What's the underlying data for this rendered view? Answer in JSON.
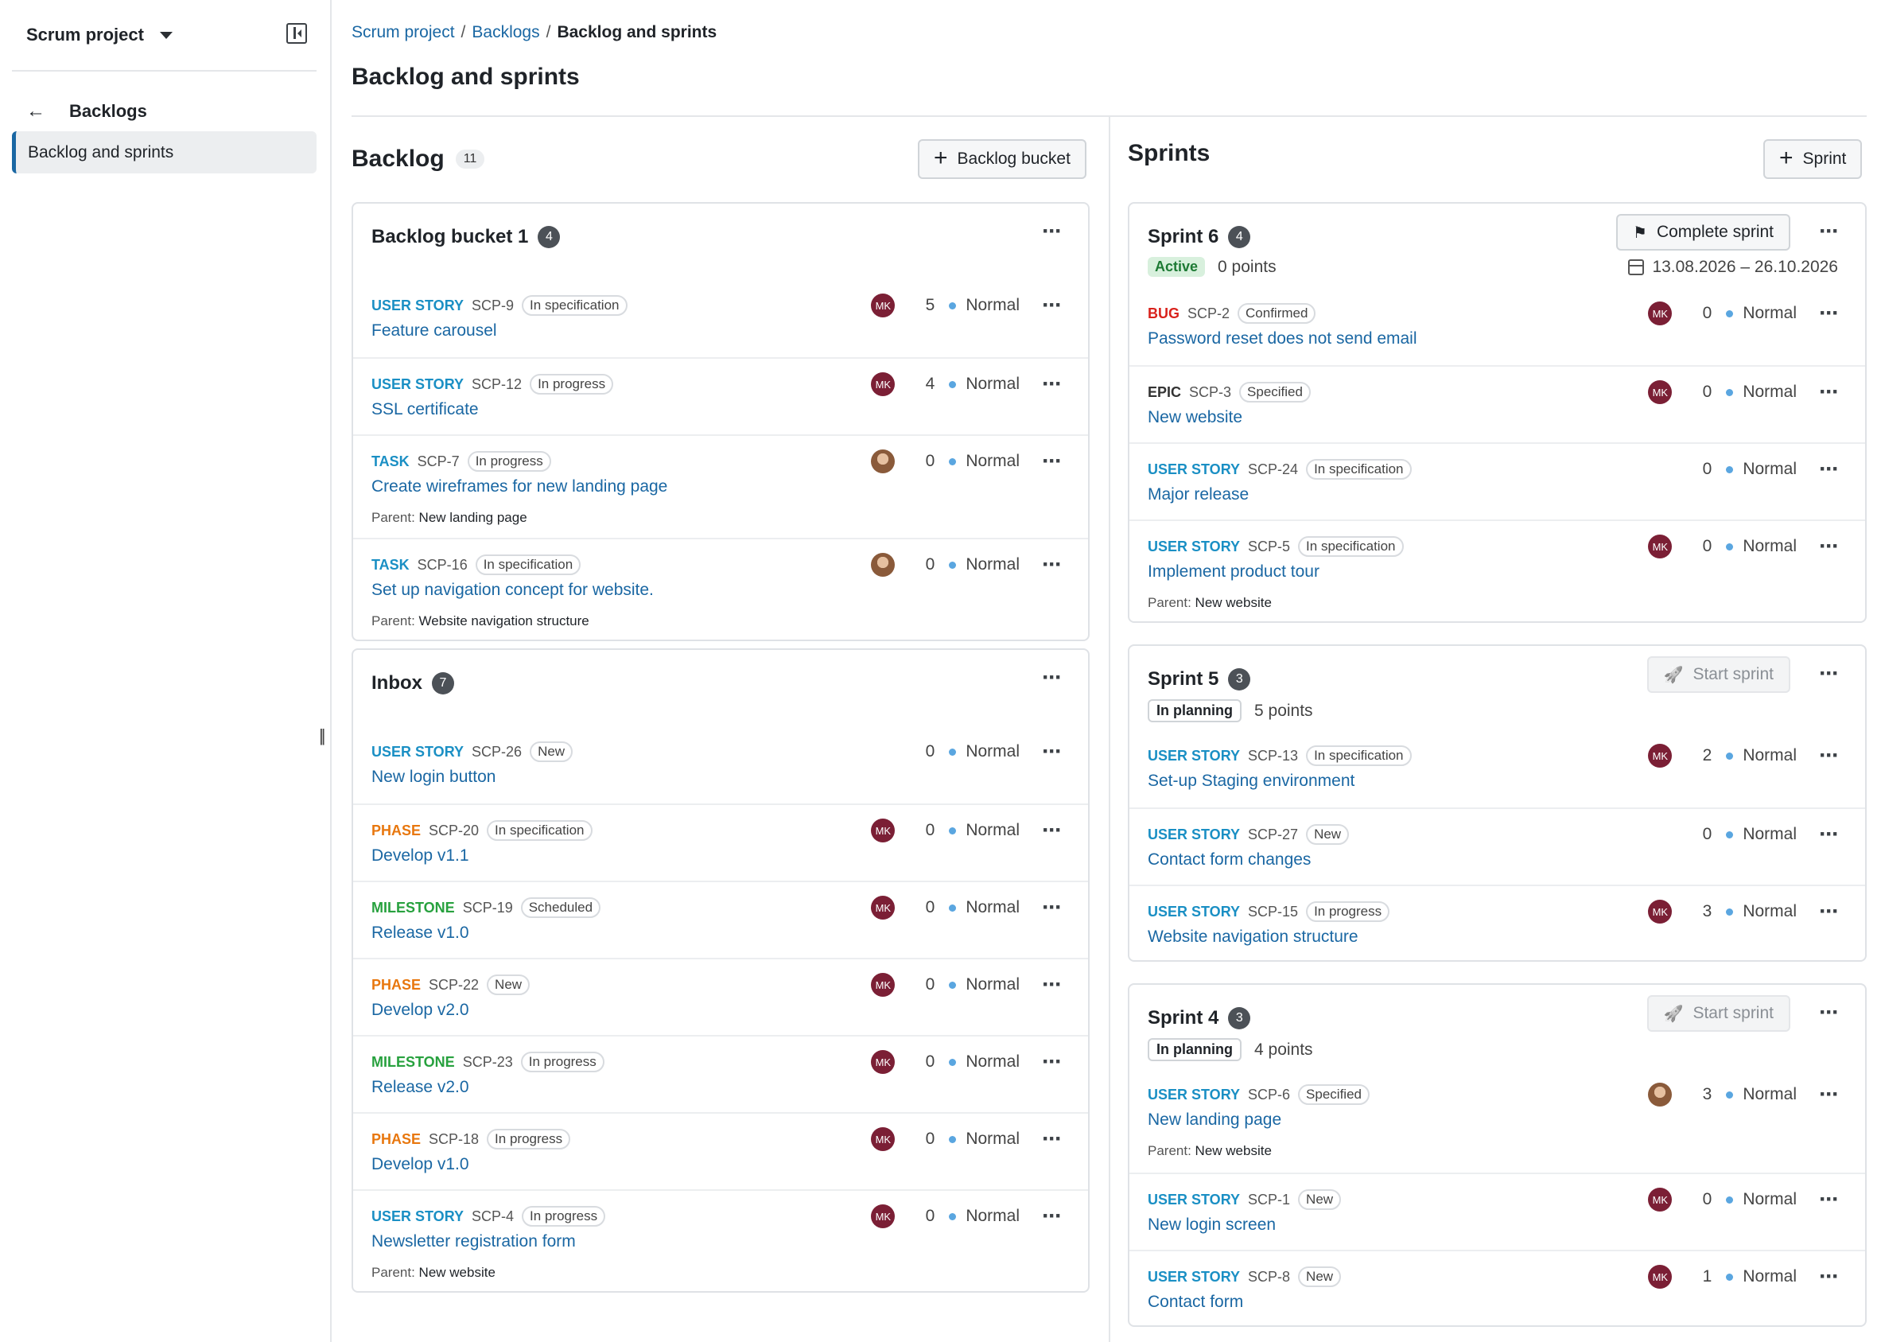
{
  "sidebar": {
    "project": "Scrum project",
    "back_label": "Backlogs",
    "active_item": "Backlog and sprints"
  },
  "breadcrumb": [
    "Scrum project",
    "Backlogs",
    "Backlog and sprints"
  ],
  "page_title": "Backlog and sprints",
  "backlog": {
    "title": "Backlog",
    "count": "11",
    "add_button": "Backlog bucket",
    "buckets": [
      {
        "name": "Backlog bucket 1",
        "count": "4",
        "items": [
          {
            "type": "USER STORY",
            "id": "SCP-9",
            "status": "In specification",
            "subject": "Feature carousel",
            "avatar": "MK",
            "points": "5",
            "priority": "Normal"
          },
          {
            "type": "USER STORY",
            "id": "SCP-12",
            "status": "In progress",
            "subject": "SSL certificate",
            "avatar": "MK",
            "points": "4",
            "priority": "Normal"
          },
          {
            "type": "TASK",
            "id": "SCP-7",
            "status": "In progress",
            "subject": "Create wireframes for new landing page",
            "parent_label": "Parent:",
            "parent": "New landing page",
            "avatar": "photo",
            "points": "0",
            "priority": "Normal"
          },
          {
            "type": "TASK",
            "id": "SCP-16",
            "status": "In specification",
            "subject": "Set up navigation concept for website.",
            "parent_label": "Parent:",
            "parent": "Website navigation structure",
            "avatar": "photo",
            "points": "0",
            "priority": "Normal"
          }
        ]
      },
      {
        "name": "Inbox",
        "count": "7",
        "items": [
          {
            "type": "USER STORY",
            "id": "SCP-26",
            "status": "New",
            "subject": "New login button",
            "avatar": "",
            "points": "0",
            "priority": "Normal"
          },
          {
            "type": "PHASE",
            "id": "SCP-20",
            "status": "In specification",
            "subject": "Develop v1.1",
            "avatar": "MK",
            "points": "0",
            "priority": "Normal"
          },
          {
            "type": "MILESTONE",
            "id": "SCP-19",
            "status": "Scheduled",
            "subject": "Release v1.0",
            "avatar": "MK",
            "points": "0",
            "priority": "Normal"
          },
          {
            "type": "PHASE",
            "id": "SCP-22",
            "status": "New",
            "subject": "Develop v2.0",
            "avatar": "MK",
            "points": "0",
            "priority": "Normal"
          },
          {
            "type": "MILESTONE",
            "id": "SCP-23",
            "status": "In progress",
            "subject": "Release v2.0",
            "avatar": "MK",
            "points": "0",
            "priority": "Normal"
          },
          {
            "type": "PHASE",
            "id": "SCP-18",
            "status": "In progress",
            "subject": "Develop v1.0",
            "avatar": "MK",
            "points": "0",
            "priority": "Normal"
          },
          {
            "type": "USER STORY",
            "id": "SCP-4",
            "status": "In progress",
            "subject": "Newsletter registration form",
            "parent_label": "Parent:",
            "parent": "New website",
            "avatar": "MK",
            "points": "0",
            "priority": "Normal"
          }
        ]
      }
    ]
  },
  "sprints": {
    "title": "Sprints",
    "add_button": "Sprint",
    "list": [
      {
        "name": "Sprint 6",
        "count": "4",
        "state": "Active",
        "points": "0 points",
        "action": "Complete sprint",
        "dates": "13.08.2026 – 26.10.2026",
        "items": [
          {
            "type": "BUG",
            "id": "SCP-2",
            "status": "Confirmed",
            "subject": "Password reset does not send email",
            "avatar": "MK",
            "points": "0",
            "priority": "Normal"
          },
          {
            "type": "EPIC",
            "id": "SCP-3",
            "status": "Specified",
            "subject": "New website",
            "avatar": "MK",
            "points": "0",
            "priority": "Normal"
          },
          {
            "type": "USER STORY",
            "id": "SCP-24",
            "status": "In specification",
            "subject": "Major release",
            "avatar": "",
            "points": "0",
            "priority": "Normal"
          },
          {
            "type": "USER STORY",
            "id": "SCP-5",
            "status": "In specification",
            "subject": "Implement product tour",
            "parent_label": "Parent:",
            "parent": "New website",
            "avatar": "MK",
            "points": "0",
            "priority": "Normal"
          }
        ]
      },
      {
        "name": "Sprint 5",
        "count": "3",
        "state": "In planning",
        "points": "5 points",
        "action": "Start sprint",
        "dates": "",
        "items": [
          {
            "type": "USER STORY",
            "id": "SCP-13",
            "status": "In specification",
            "subject": "Set-up Staging environment",
            "avatar": "MK",
            "points": "2",
            "priority": "Normal"
          },
          {
            "type": "USER STORY",
            "id": "SCP-27",
            "status": "New",
            "subject": "Contact form changes",
            "avatar": "",
            "points": "0",
            "priority": "Normal"
          },
          {
            "type": "USER STORY",
            "id": "SCP-15",
            "status": "In progress",
            "subject": "Website navigation structure",
            "avatar": "MK",
            "points": "3",
            "priority": "Normal"
          }
        ]
      },
      {
        "name": "Sprint 4",
        "count": "3",
        "state": "In planning",
        "points": "4 points",
        "action": "Start sprint",
        "dates": "",
        "items": [
          {
            "type": "USER STORY",
            "id": "SCP-6",
            "status": "Specified",
            "subject": "New landing page",
            "parent_label": "Parent:",
            "parent": "New website",
            "avatar": "photo",
            "points": "3",
            "priority": "Normal"
          },
          {
            "type": "USER STORY",
            "id": "SCP-1",
            "status": "New",
            "subject": "New login screen",
            "avatar": "MK",
            "points": "0",
            "priority": "Normal"
          },
          {
            "type": "USER STORY",
            "id": "SCP-8",
            "status": "New",
            "subject": "Contact form",
            "avatar": "MK",
            "points": "1",
            "priority": "Normal"
          }
        ]
      }
    ]
  },
  "colors": {
    "link": "#1a67a3",
    "user_story": "#1a8fc4",
    "bug": "#d9221c",
    "phase": "#e8770e",
    "milestone": "#27a13e",
    "avatar": "#7b1f35",
    "active_state": "#d8f0dd"
  },
  "icons": [
    "chevron-down-icon",
    "sidebar-collapse-icon",
    "arrow-left-icon",
    "plus-icon",
    "flag-icon",
    "rocket-icon",
    "calendar-icon",
    "more-icon",
    "priority-dot-icon"
  ]
}
